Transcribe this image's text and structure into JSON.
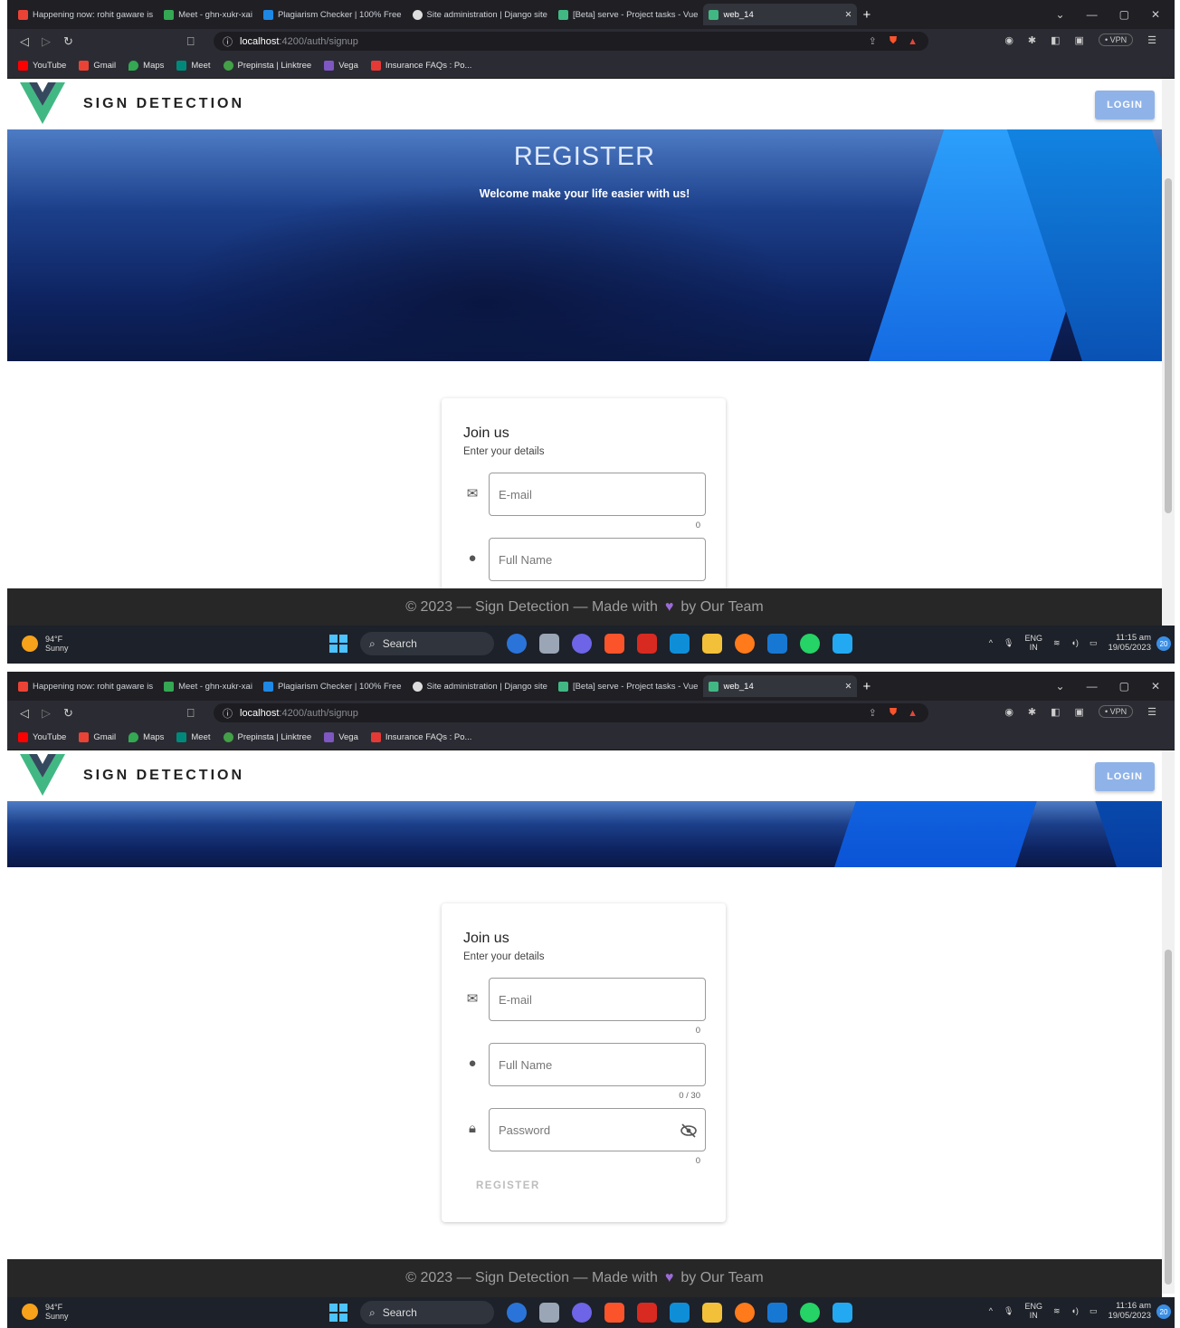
{
  "browser": {
    "tabs": [
      {
        "label": "Happening now: rohit gaware is",
        "color": "#ea4335"
      },
      {
        "label": "Meet - ghn-xukr-xai",
        "color": "#34a853"
      },
      {
        "label": "Plagiarism Checker | 100% Free",
        "color": "#1e88e5"
      },
      {
        "label": "Site administration | Django site",
        "color": "#dddddd"
      },
      {
        "label": "[Beta] serve - Project tasks - Vue",
        "color": "#41b883"
      },
      {
        "label": "web_14",
        "color": "#41b883"
      }
    ],
    "new_tab": "+",
    "url_host": "localhost",
    "url_path": ":4200/auth/signup",
    "vpn_label": "• VPN",
    "bookmarks": [
      {
        "label": "YouTube",
        "color": "#ff0000"
      },
      {
        "label": "Gmail",
        "color": "#ea4335"
      },
      {
        "label": "Maps",
        "color": "#34a853"
      },
      {
        "label": "Meet",
        "color": "#00897b"
      },
      {
        "label": "Prepinsta | Linktree",
        "color": "#43a047"
      },
      {
        "label": "Vega",
        "color": "#7e57c2"
      },
      {
        "label": "Insurance FAQs : Po...",
        "color": "#e53935"
      }
    ]
  },
  "app": {
    "brand": "SIGN DETECTION",
    "login_label": "LOGIN",
    "hero_title": "REGISTER",
    "hero_subtitle": "Welcome make your life easier with us!"
  },
  "form": {
    "title": "Join us",
    "subtitle": "Enter your details",
    "email_placeholder": "E-mail",
    "email_counter": "0",
    "fullname_placeholder": "Full Name",
    "fullname_counter": "0 / 30",
    "password_placeholder": "Password",
    "password_counter": "0",
    "register_label": "REGISTER"
  },
  "footer": {
    "before": "© 2023 — Sign Detection — Made with",
    "after": "by Our Team"
  },
  "taskbar": {
    "temp": "94°F",
    "condition": "Sunny",
    "search": "Search",
    "lang": "ENG",
    "region": "IN",
    "time_1": "11:15 am",
    "time_2": "11:16 am",
    "date": "19/05/2023",
    "notifications": "20"
  },
  "accent": {
    "vue_green": "#41b883",
    "vue_dark": "#35495e",
    "login_blue": "#8fb3e8"
  }
}
